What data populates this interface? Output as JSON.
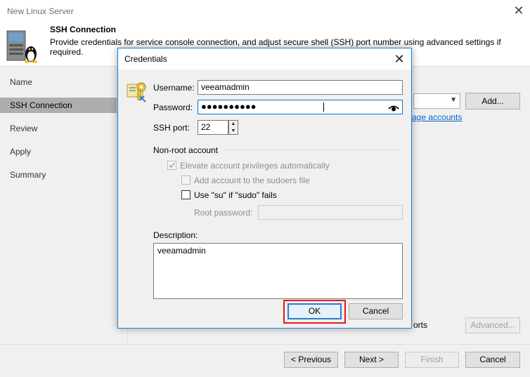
{
  "window": {
    "title": "New Linux Server",
    "close_icon": "close-icon"
  },
  "header": {
    "title": "SSH Connection",
    "description": "Provide credentials for service console connection, and adjust secure shell (SSH) port number using advanced settings if required."
  },
  "steps": [
    {
      "label": "Name",
      "active": false
    },
    {
      "label": "SSH Connection",
      "active": true
    },
    {
      "label": "Review",
      "active": false
    },
    {
      "label": "Apply",
      "active": false
    },
    {
      "label": "Summary",
      "active": false
    }
  ],
  "background_panel": {
    "add_label": "Add...",
    "manage_link": "age accounts",
    "ports_text": "orts",
    "advanced_label": "Advanced..."
  },
  "footer": {
    "previous": "< Previous",
    "next": "Next >",
    "finish": "Finish",
    "cancel": "Cancel"
  },
  "dialog": {
    "title": "Credentials",
    "username_label": "Username:",
    "username_value": "veeamadmin",
    "password_label": "Password:",
    "password_mask": "●●●●●●●●●●",
    "ssh_port_label": "SSH port:",
    "ssh_port_value": "22",
    "nonroot_section": "Non-root account",
    "elevate_label": "Elevate account privileges automatically",
    "elevate_checked": true,
    "sudoers_label": "Add account to the sudoers file",
    "sudoers_checked": false,
    "su_label": "Use \"su\" if \"sudo\" fails",
    "su_checked": false,
    "root_password_label": "Root password:",
    "description_label": "Description:",
    "description_value": "veeamadmin",
    "ok_label": "OK",
    "cancel_label": "Cancel"
  },
  "colors": {
    "accent": "#1883d7",
    "active_step": "#aeaeae",
    "highlight": "#e01b1b",
    "link": "#0066cc"
  }
}
